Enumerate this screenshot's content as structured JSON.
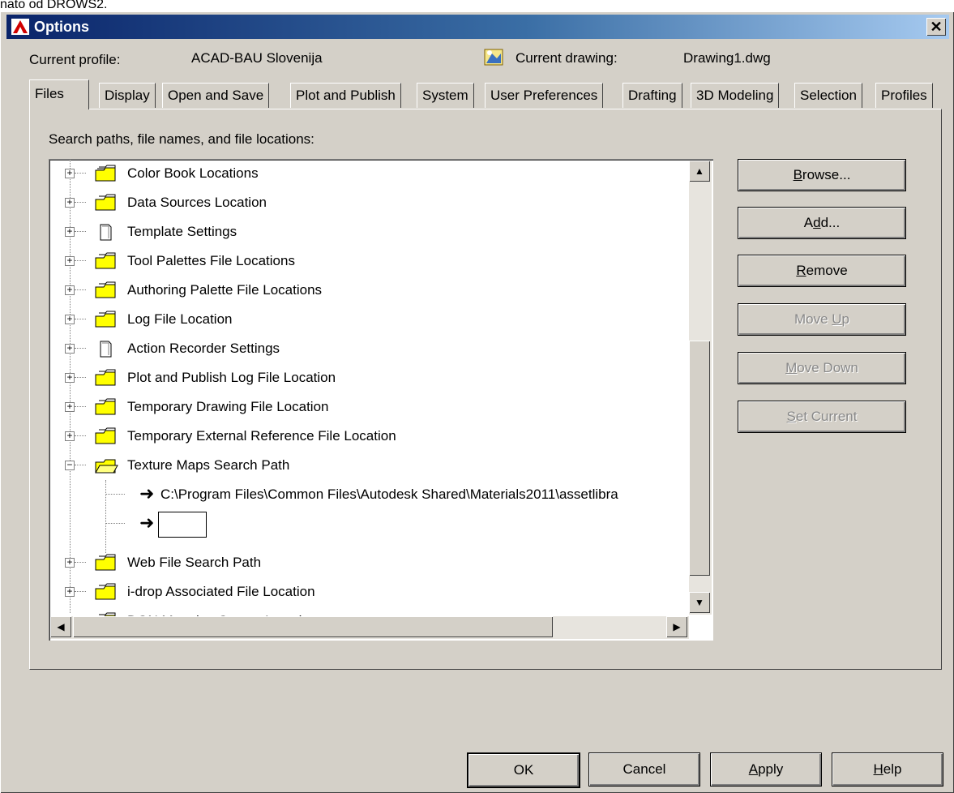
{
  "top_fragment": "nato od DROWS2.",
  "window": {
    "title": "Options",
    "close_glyph": "✕"
  },
  "profile": {
    "current_profile_label": "Current profile:",
    "current_profile_value": "ACAD-BAU Slovenija",
    "current_drawing_label": "Current drawing:",
    "current_drawing_value": "Drawing1.dwg"
  },
  "tabs": [
    {
      "label": "Files",
      "active": true
    },
    {
      "label": "Display"
    },
    {
      "label": "Open and Save"
    },
    {
      "label": "Plot and Publish"
    },
    {
      "label": "System"
    },
    {
      "label": "User Preferences"
    },
    {
      "label": "Drafting"
    },
    {
      "label": "3D Modeling"
    },
    {
      "label": "Selection"
    },
    {
      "label": "Profiles"
    }
  ],
  "files_tab": {
    "section_label": "Search paths, file names, and file locations:",
    "tree": [
      {
        "label": "Color Book Locations",
        "icon": "folder-stack-icon",
        "expander": "+"
      },
      {
        "label": "Data Sources Location",
        "icon": "folder-stack-icon",
        "expander": "+"
      },
      {
        "label": "Template Settings",
        "icon": "document-icon",
        "expander": "+"
      },
      {
        "label": "Tool Palettes File Locations",
        "icon": "folder-stack-icon",
        "expander": "+"
      },
      {
        "label": "Authoring Palette File Locations",
        "icon": "folder-stack-icon",
        "expander": "+"
      },
      {
        "label": "Log File Location",
        "icon": "folder-stack-icon",
        "expander": "+"
      },
      {
        "label": "Action Recorder Settings",
        "icon": "document-icon",
        "expander": "+"
      },
      {
        "label": "Plot and Publish Log File Location",
        "icon": "folder-stack-icon",
        "expander": "+"
      },
      {
        "label": "Temporary Drawing File Location",
        "icon": "folder-stack-icon",
        "expander": "+"
      },
      {
        "label": "Temporary External Reference File Location",
        "icon": "folder-stack-icon",
        "expander": "+"
      },
      {
        "label": "Texture Maps Search Path",
        "icon": "folder-open-icon",
        "expander": "−"
      },
      {
        "label": "C:\\Program Files\\Common Files\\Autodesk Shared\\Materials2011\\assetlibra",
        "icon": "arrow-icon",
        "child": true
      },
      {
        "label": "",
        "icon": "arrow-icon",
        "child": true,
        "editing": true
      },
      {
        "label": "Web File Search Path",
        "icon": "folder-stack-icon",
        "expander": "+"
      },
      {
        "label": "i-drop Associated File Location",
        "icon": "folder-stack-icon",
        "expander": "+"
      },
      {
        "label": "DGN Mapping Setups Location",
        "icon": "folder-stack-icon",
        "expander": "+"
      }
    ],
    "side_buttons": {
      "browse": {
        "label": "Browse...",
        "mnemonic": "B",
        "rest": "rowse..."
      },
      "add": {
        "label": "Add...",
        "pre": "A",
        "mnemonic": "d",
        "rest": "d..."
      },
      "remove": {
        "label": "Remove",
        "mnemonic": "R",
        "rest": "emove"
      },
      "move_up": {
        "label": "Move Up",
        "pre": "Move ",
        "mnemonic": "U",
        "rest": "p"
      },
      "move_down": {
        "label": "Move Down",
        "mnemonic": "M",
        "rest": "ove Down"
      },
      "set_current": {
        "label": "Set Current",
        "mnemonic": "S",
        "rest": "et Current"
      }
    }
  },
  "footer": {
    "ok": "OK",
    "cancel": "Cancel",
    "apply_mnemonic": "A",
    "apply_rest": "pply",
    "help_mnemonic": "H",
    "help_rest": "elp"
  },
  "colors": {
    "dialog_bg": "#d4d0c8",
    "titlebar_start": "#0a246a",
    "titlebar_end": "#a6caf0",
    "folder_yellow": "#ffff00"
  }
}
